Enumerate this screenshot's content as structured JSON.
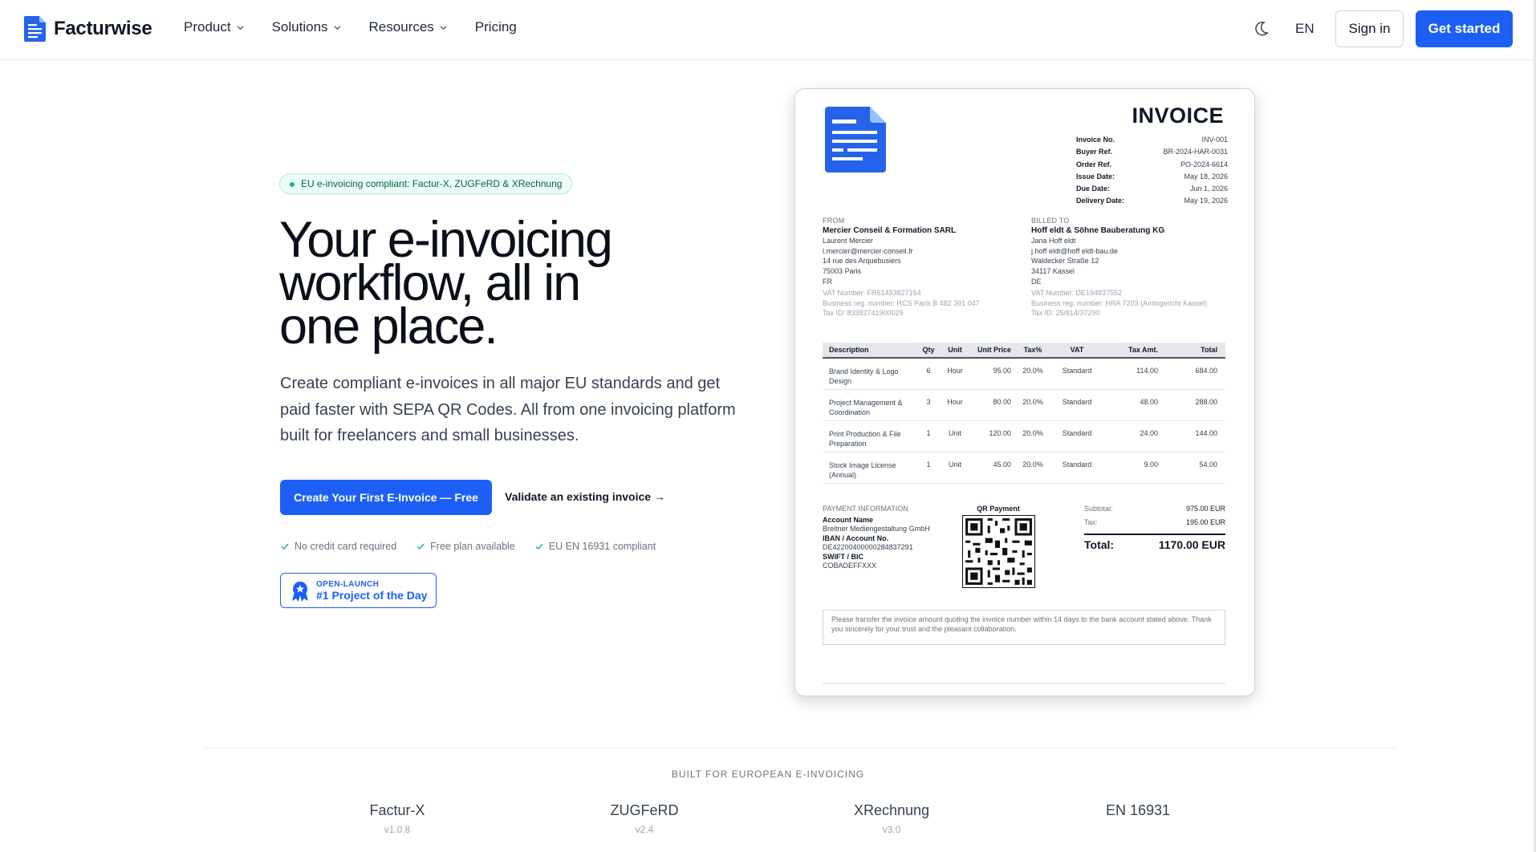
{
  "brand": {
    "name": "Facturwise",
    "accent": "#1d5ff5"
  },
  "nav": {
    "items": [
      {
        "label": "Product",
        "has_menu": true
      },
      {
        "label": "Solutions",
        "has_menu": true
      },
      {
        "label": "Resources",
        "has_menu": true
      },
      {
        "label": "Pricing",
        "has_menu": false
      }
    ],
    "theme_icon": "moon-icon",
    "language": "EN",
    "signin_label": "Sign in",
    "cta_label": "Get started"
  },
  "hero": {
    "badge": "EU e-invoicing compliant: Factur-X, ZUGFeRD & XRechnung",
    "title_lines": [
      "Your e-invoicing",
      "workflow, all in",
      "one place."
    ],
    "subtitle": "Create compliant e-invoices in all major EU standards and get paid faster with SEPA QR Codes. All from one invoicing platform built for freelancers and small businesses.",
    "primary_cta": "Create Your First E-Invoice — Free",
    "secondary_cta": "Validate an existing invoice →",
    "checks": [
      "No credit card required",
      "Free plan available",
      "EU EN 16931 compliant"
    ],
    "award": {
      "top": "OPEN-LAUNCH",
      "main": "#1 Project of the Day"
    }
  },
  "invoice": {
    "title": "INVOICE",
    "meta": [
      {
        "k": "Invoice No.",
        "v": "INV-001"
      },
      {
        "k": "Buyer Ref.",
        "v": "BR-2024-HAR-0031"
      },
      {
        "k": "Order Ref.",
        "v": "PO-2024-6614"
      },
      {
        "k": "Issue Date:",
        "v": "May 18, 2026"
      },
      {
        "k": "Due Date:",
        "v": "Jun 1, 2026"
      },
      {
        "k": "Delivery Date:",
        "v": "May 19, 2026"
      }
    ],
    "from": {
      "label": "FROM",
      "name": "Mercier Conseil & Formation SARL",
      "lines": [
        "Laurent Mercier",
        "l.mercier@mercier-conseil.fr",
        "14 rue des Arquebusiers",
        "75003 Paris",
        "FR"
      ],
      "reg": [
        "VAT Number: FR61493827154",
        "Business reg. number: RCS Paris B 482 391 047",
        "Tax ID: 83382741900029"
      ]
    },
    "billed": {
      "label": "BILLED TO",
      "name": "Hoff eldt & Söhne Bauberatung KG",
      "lines": [
        "Jana Hoff eldt",
        "j.hoff eldt@hoff eldt-bau.de",
        "Waldecker Straße 12",
        "34117 Kassel",
        "DE"
      ],
      "reg": [
        "VAT Number: DE194837552",
        "Business reg. number: HRA 7203 (Amtsgericht Kassel)",
        "Tax ID: 25/814/37290"
      ]
    },
    "columns": [
      "Description",
      "Qty",
      "Unit",
      "Unit Price",
      "Tax%",
      "VAT",
      "Tax Amt.",
      "Total"
    ],
    "rows": [
      [
        "Brand Identity & Logo Design",
        "6",
        "Hour",
        "95.00",
        "20.0%",
        "Standard",
        "114.00",
        "684.00"
      ],
      [
        "Project Management & Coordination",
        "3",
        "Hour",
        "80.00",
        "20.0%",
        "Standard",
        "48.00",
        "288.00"
      ],
      [
        "Print Production & File Preparation",
        "1",
        "Unit",
        "120.00",
        "20.0%",
        "Standard",
        "24.00",
        "144.00"
      ],
      [
        "Stock Image License (Annual)",
        "1",
        "Unit",
        "45.00",
        "20.0%",
        "Standard",
        "9.00",
        "54.00"
      ]
    ],
    "payment": {
      "label": "PAYMENT INFORMATION",
      "account_name_label": "Account Name",
      "account_name": "Breitner Mediengestaltung GmbH",
      "iban_label": "IBAN / Account No.",
      "iban": "DE42200400000284837291",
      "bic_label": "SWIFT / BIC",
      "bic": "COBADEFFXXX"
    },
    "qr_label": "QR Payment",
    "totals": {
      "subtotal_label": "Subtotal:",
      "subtotal": "975.00 EUR",
      "tax_label": "Tax:",
      "tax": "195.00 EUR",
      "total_label": "Total:",
      "total": "1170.00 EUR"
    },
    "note": "Please transfer the invoice amount quoting the invoice number within 14 days to the bank account stated above. Thank you sincerely for your trust and the pleasant collaboration."
  },
  "standards": {
    "heading": "BUILT FOR EUROPEAN E-INVOICING",
    "items": [
      {
        "name": "Factur-X",
        "version": "v1.0.8"
      },
      {
        "name": "ZUGFeRD",
        "version": "v2.4"
      },
      {
        "name": "XRechnung",
        "version": "v3.0"
      },
      {
        "name": "EN 16931",
        "version": ""
      }
    ]
  }
}
